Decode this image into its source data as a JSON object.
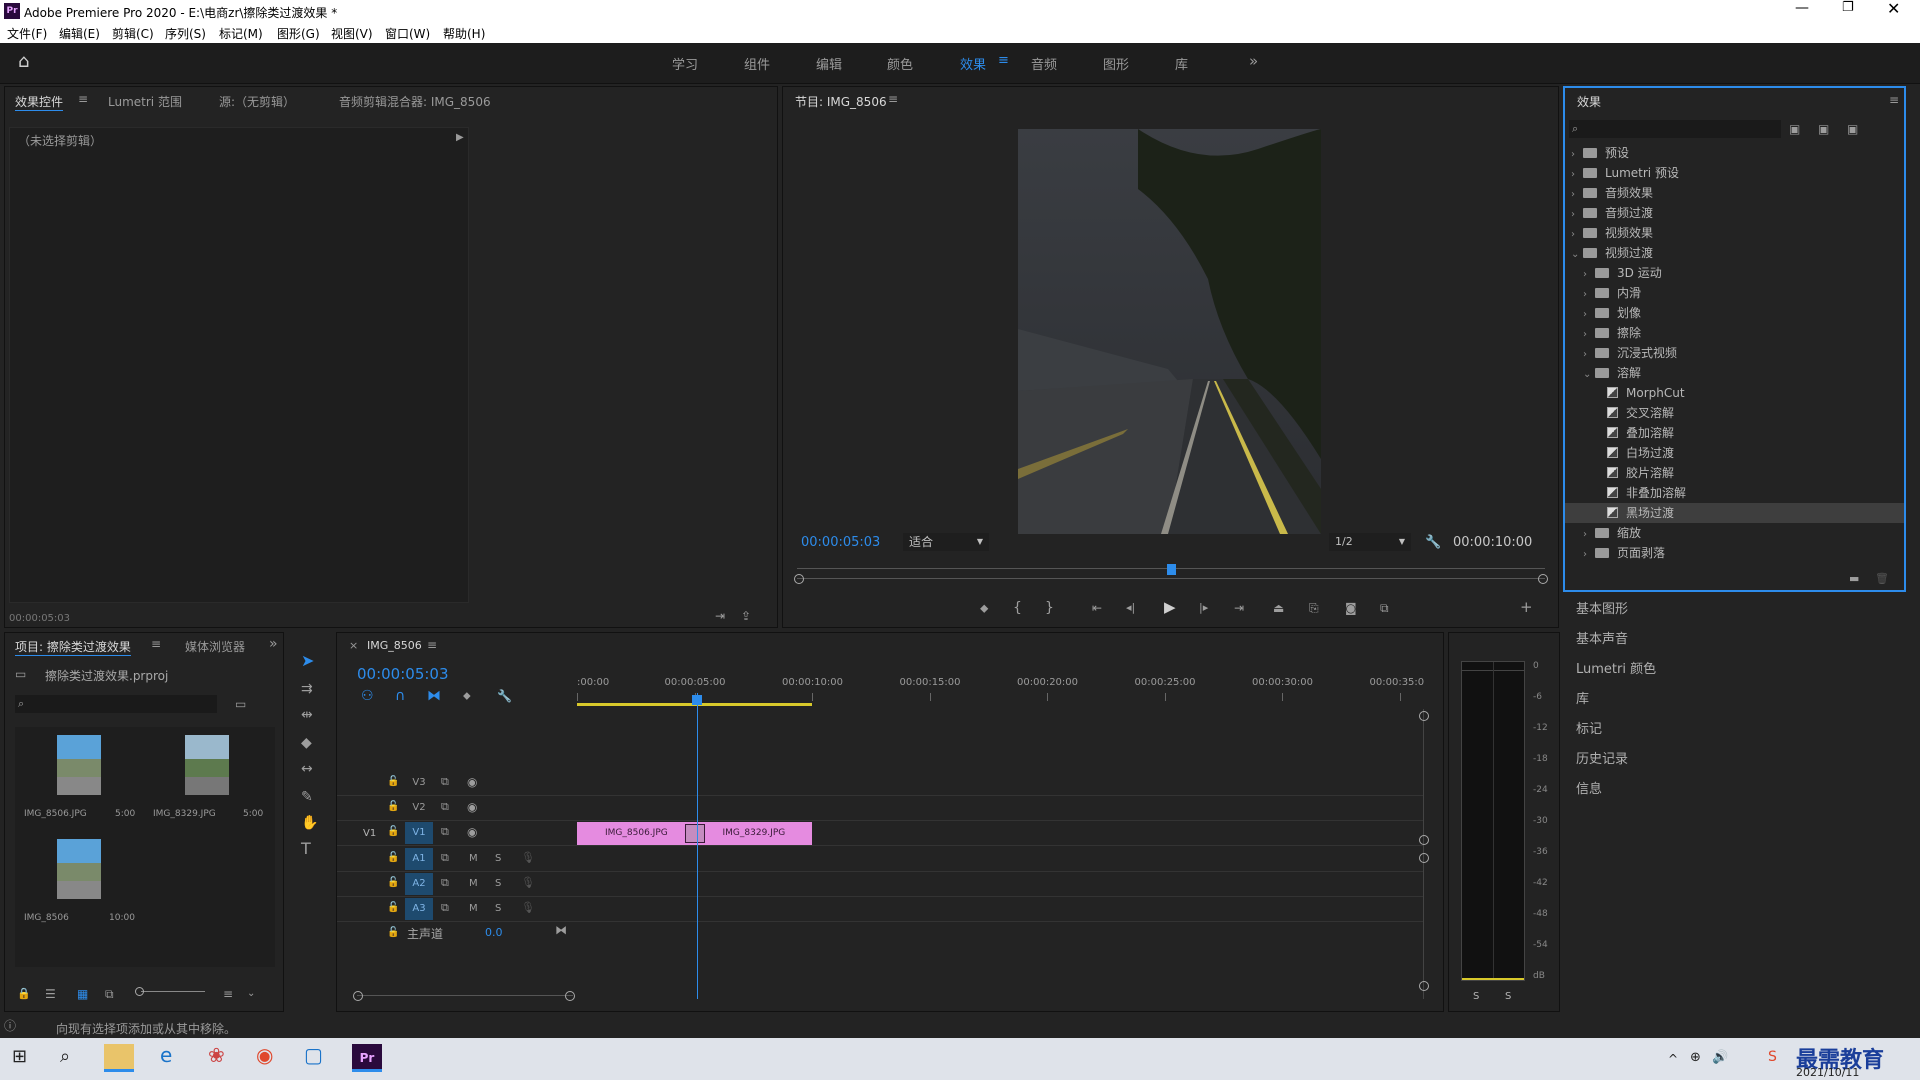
{
  "window": {
    "title": "Adobe Premiere Pro 2020 - E:\\电商zr\\擦除类过渡效果 *",
    "app_icon": "Pr"
  },
  "menu": [
    "文件(F)",
    "编辑(E)",
    "剪辑(C)",
    "序列(S)",
    "标记(M)",
    "图形(G)",
    "视图(V)",
    "窗口(W)",
    "帮助(H)"
  ],
  "workspaces": [
    "学习",
    "组件",
    "编辑",
    "颜色",
    "效果",
    "音频",
    "图形",
    "库"
  ],
  "active_workspace": "效果",
  "source_panel": {
    "tabs": [
      "效果控件",
      "Lumetri 范围",
      "源:（无剪辑）",
      "音频剪辑混合器: IMG_8506"
    ],
    "no_clip": "（未选择剪辑）",
    "timecode": "00:00:05:03"
  },
  "program": {
    "title": "节目: IMG_8506",
    "timecode": "00:00:05:03",
    "fit": "适合",
    "resolution": "1/2",
    "duration": "00:00:10:00",
    "playhead_fraction": 0.5
  },
  "effects": {
    "title": "效果",
    "tree": [
      {
        "label": "预设",
        "level": 0,
        "type": "folder",
        "open": false
      },
      {
        "label": "Lumetri 预设",
        "level": 0,
        "type": "folder",
        "open": false
      },
      {
        "label": "音频效果",
        "level": 0,
        "type": "folder",
        "open": false
      },
      {
        "label": "音频过渡",
        "level": 0,
        "type": "folder",
        "open": false
      },
      {
        "label": "视频效果",
        "level": 0,
        "type": "folder",
        "open": false
      },
      {
        "label": "视频过渡",
        "level": 0,
        "type": "folder",
        "open": true
      },
      {
        "label": "3D 运动",
        "level": 1,
        "type": "folder",
        "open": false
      },
      {
        "label": "内滑",
        "level": 1,
        "type": "folder",
        "open": false
      },
      {
        "label": "划像",
        "level": 1,
        "type": "folder",
        "open": false
      },
      {
        "label": "擦除",
        "level": 1,
        "type": "folder",
        "open": false
      },
      {
        "label": "沉浸式视频",
        "level": 1,
        "type": "folder",
        "open": false
      },
      {
        "label": "溶解",
        "level": 1,
        "type": "folder",
        "open": true
      },
      {
        "label": "MorphCut",
        "level": 2,
        "type": "fx"
      },
      {
        "label": "交叉溶解",
        "level": 2,
        "type": "fx"
      },
      {
        "label": "叠加溶解",
        "level": 2,
        "type": "fx"
      },
      {
        "label": "白场过渡",
        "level": 2,
        "type": "fx"
      },
      {
        "label": "胶片溶解",
        "level": 2,
        "type": "fx"
      },
      {
        "label": "非叠加溶解",
        "level": 2,
        "type": "fx"
      },
      {
        "label": "黑场过渡",
        "level": 2,
        "type": "fx",
        "selected": true
      },
      {
        "label": "缩放",
        "level": 1,
        "type": "folder",
        "open": false
      },
      {
        "label": "页面剥落",
        "level": 1,
        "type": "folder",
        "open": false
      }
    ]
  },
  "side_panels": [
    "基本图形",
    "基本声音",
    "Lumetri 颜色",
    "库",
    "标记",
    "历史记录",
    "信息"
  ],
  "project": {
    "tabs": [
      "项目: 擦除类过渡效果",
      "媒体浏览器"
    ],
    "file": "擦除类过渡效果.prproj",
    "items": [
      {
        "name": "IMG_8506.JPG",
        "dur": "5:00"
      },
      {
        "name": "IMG_8329.JPG",
        "dur": "5:00"
      },
      {
        "name": "IMG_8506",
        "dur": "10:00"
      }
    ]
  },
  "timeline": {
    "tab": "IMG_8506",
    "timecode": "00:00:05:03",
    "ruler": [
      ":00:00",
      "00:00:05:00",
      "00:00:10:00",
      "00:00:15:00",
      "00:00:20:00",
      "00:00:25:00",
      "00:00:30:00",
      "00:00:35:0"
    ],
    "video_tracks": [
      "V3",
      "V2",
      "V1"
    ],
    "audio_tracks": [
      "A1",
      "A2",
      "A3"
    ],
    "master": "主声道",
    "master_val": "0.0",
    "src_v": "V1",
    "clips": [
      {
        "name": "IMG_8506.JPG",
        "start": 0,
        "end": 5
      },
      {
        "name": "IMG_8329.JPG",
        "start": 5,
        "end": 10
      }
    ],
    "playhead": 5.1
  },
  "meter": {
    "scale": [
      "0",
      "-6",
      "-12",
      "-18",
      "-24",
      "-30",
      "-36",
      "-42",
      "-48",
      "-54",
      "dB"
    ],
    "solo": [
      "S",
      "S"
    ]
  },
  "status": "向现有选择项添加或从其中移除。",
  "taskbar": {
    "date": "2021/10/11",
    "watermark": "最需教育"
  }
}
